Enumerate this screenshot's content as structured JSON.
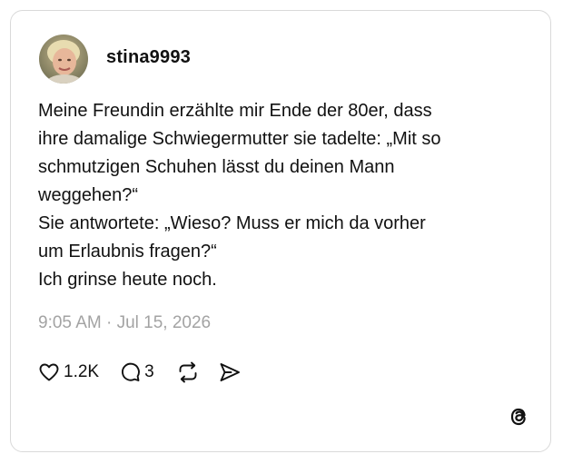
{
  "post": {
    "username": "stina9993",
    "text": "Meine Freundin erzählte mir Ende der 80er, dass\nihre damalige Schwiegermutter sie tadelte: „Mit so\nschmutzigen Schuhen lässt du deinen Mann\nweggehen?“\nSie antwortete: „Wieso? Muss er mich da vorher\num Erlaubnis fragen?“\nIch grinse heute noch.",
    "timestamp": "9:05 AM · Jul 15, 2026"
  },
  "actions": {
    "like": {
      "icon": "heart-icon",
      "count": "1.2K"
    },
    "reply": {
      "icon": "comment-icon",
      "count": "3"
    },
    "repost": {
      "icon": "repost-icon"
    },
    "share": {
      "icon": "send-icon"
    }
  },
  "branding": {
    "icon": "threads-logo-icon"
  },
  "colors": {
    "text": "#111111",
    "muted": "#a3a3a3",
    "border": "#d9d9d9"
  }
}
